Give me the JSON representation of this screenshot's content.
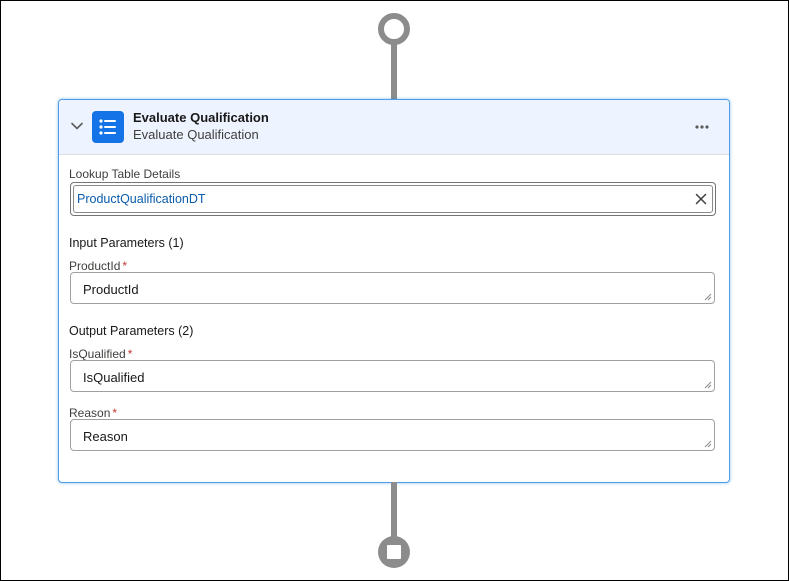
{
  "element": {
    "title": "Evaluate Qualification",
    "subtitle": "Evaluate Qualification",
    "icon": "list-icon",
    "more_icon": "more-actions-icon",
    "collapse_icon": "chevron-down-icon"
  },
  "lookup": {
    "label": "Lookup Table Details",
    "value": "ProductQualificationDT",
    "clear_icon": "close-icon"
  },
  "input_parameters": {
    "heading": "Input Parameters (1)",
    "fields": [
      {
        "label": "ProductId",
        "required_mark": "*",
        "value": "ProductId"
      }
    ]
  },
  "output_parameters": {
    "heading": "Output Parameters (2)",
    "fields": [
      {
        "label": "IsQualified",
        "required_mark": "*",
        "value": "IsQualified"
      },
      {
        "label": "Reason",
        "required_mark": "*",
        "value": "Reason"
      }
    ]
  },
  "colors": {
    "accent": "#1473e6",
    "header_bg": "#eef4ff",
    "connector": "#8c8c8c",
    "required": "#c23934",
    "link": "#0b5cab"
  }
}
